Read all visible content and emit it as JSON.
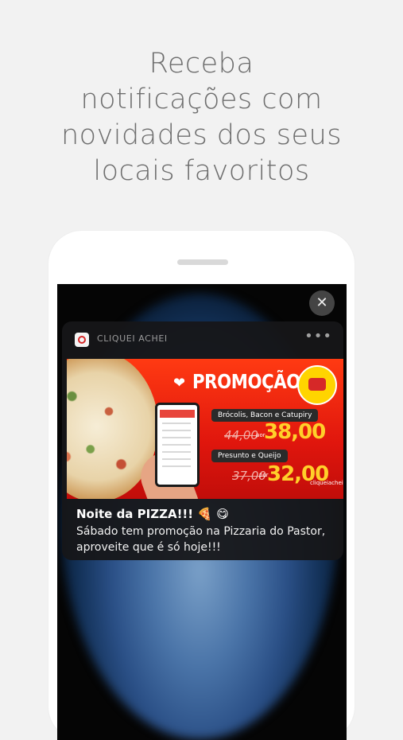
{
  "headline": {
    "lines": [
      "Receba",
      "notificações com",
      "novidades dos seus",
      "locais favoritos"
    ]
  },
  "phone": {
    "close_icon": "close-icon",
    "notification": {
      "app_name": "CLIQUEI ACHEI",
      "more_label": "•••",
      "promo": {
        "title": "PROMOÇÃO",
        "item1_label": "Brócolis, Bacon e Catupiry",
        "item1_old_price": "44,00",
        "item1_por": "por",
        "item1_new_price": "38,00",
        "item2_label": "Presunto e Queijo",
        "item2_old_price": "37,00",
        "item2_por": "por",
        "item2_new_price": "32,00",
        "brand": "cliqueiachei",
        "heart_icon": "heart-icon"
      },
      "title": "Noite da PIZZA!!! 🍕 😋",
      "body": "Sábado tem promoção na Pizzaria do Pastor, aproveite que é só hoje!!!"
    }
  },
  "colors": {
    "background": "#f2f2f2",
    "headline": "#6e6e6e",
    "promo_red": "#e0160d",
    "price_yellow": "#ffd02a"
  }
}
